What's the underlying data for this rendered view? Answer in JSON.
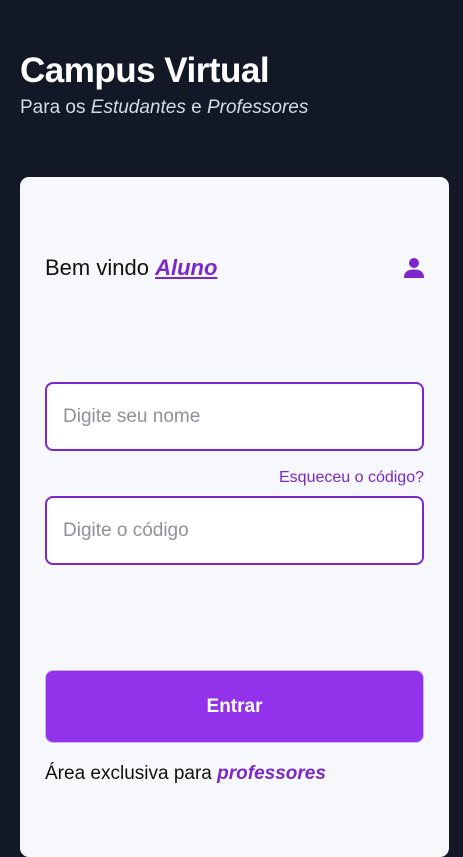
{
  "header": {
    "title": "Campus Virtual",
    "subtitle_prefix": "Para os ",
    "subtitle_students": "Estudantes",
    "subtitle_and": " e ",
    "subtitle_teachers": "Professores"
  },
  "card": {
    "welcome_prefix": "Bem vindo ",
    "role": "Aluno",
    "user_icon": "user-icon",
    "name_placeholder": "Digite seu nome",
    "name_value": "",
    "forgot_label": "Esqueceu o código?",
    "code_placeholder": "Digite o código",
    "code_value": "",
    "submit_label": "Entrar",
    "footer_prefix": "Área exclusiva para ",
    "footer_link": "professores"
  },
  "colors": {
    "background": "#121826",
    "card": "#f7f8fb",
    "accent": "#7c27c9",
    "button": "#9232ea"
  }
}
